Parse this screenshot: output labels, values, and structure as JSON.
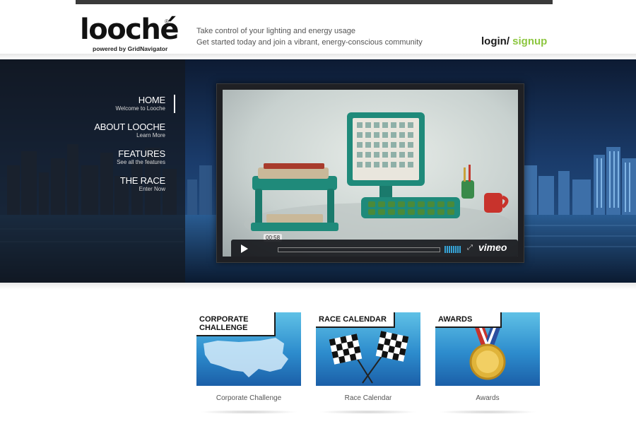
{
  "header": {
    "logo_text": "looché",
    "logo_reg": "®",
    "logo_sub": "powered by GridNavigator",
    "tagline_line1": "Take control of your lighting and energy usage",
    "tagline_line2": "Get started today and join a vibrant, energy-conscious community",
    "login_label": "login/",
    "signup_label": " signup",
    "signup_color": "#8cc63f"
  },
  "nav": {
    "items": [
      {
        "title": "HOME",
        "subtitle": "Welcome to Looche"
      },
      {
        "title": "ABOUT LOOCHE",
        "subtitle": "Learn More"
      },
      {
        "title": "FEATURES",
        "subtitle": "See all the features"
      },
      {
        "title": "THE RACE",
        "subtitle": "Enter Now"
      }
    ],
    "active_index": 0
  },
  "video": {
    "timecode": "00:58",
    "brand": "vimeo",
    "icons": [
      "play-icon",
      "volume-icon",
      "fullscreen-icon"
    ]
  },
  "tiles": [
    {
      "label": "CORPORATE CHALLENGE",
      "caption": "Corporate Challenge",
      "icon": "us-map-icon"
    },
    {
      "label": "RACE CALENDAR",
      "caption": "Race Calendar",
      "icon": "checkered-flags-icon"
    },
    {
      "label": "AWARDS",
      "caption": "Awards",
      "icon": "medal-icon"
    }
  ]
}
